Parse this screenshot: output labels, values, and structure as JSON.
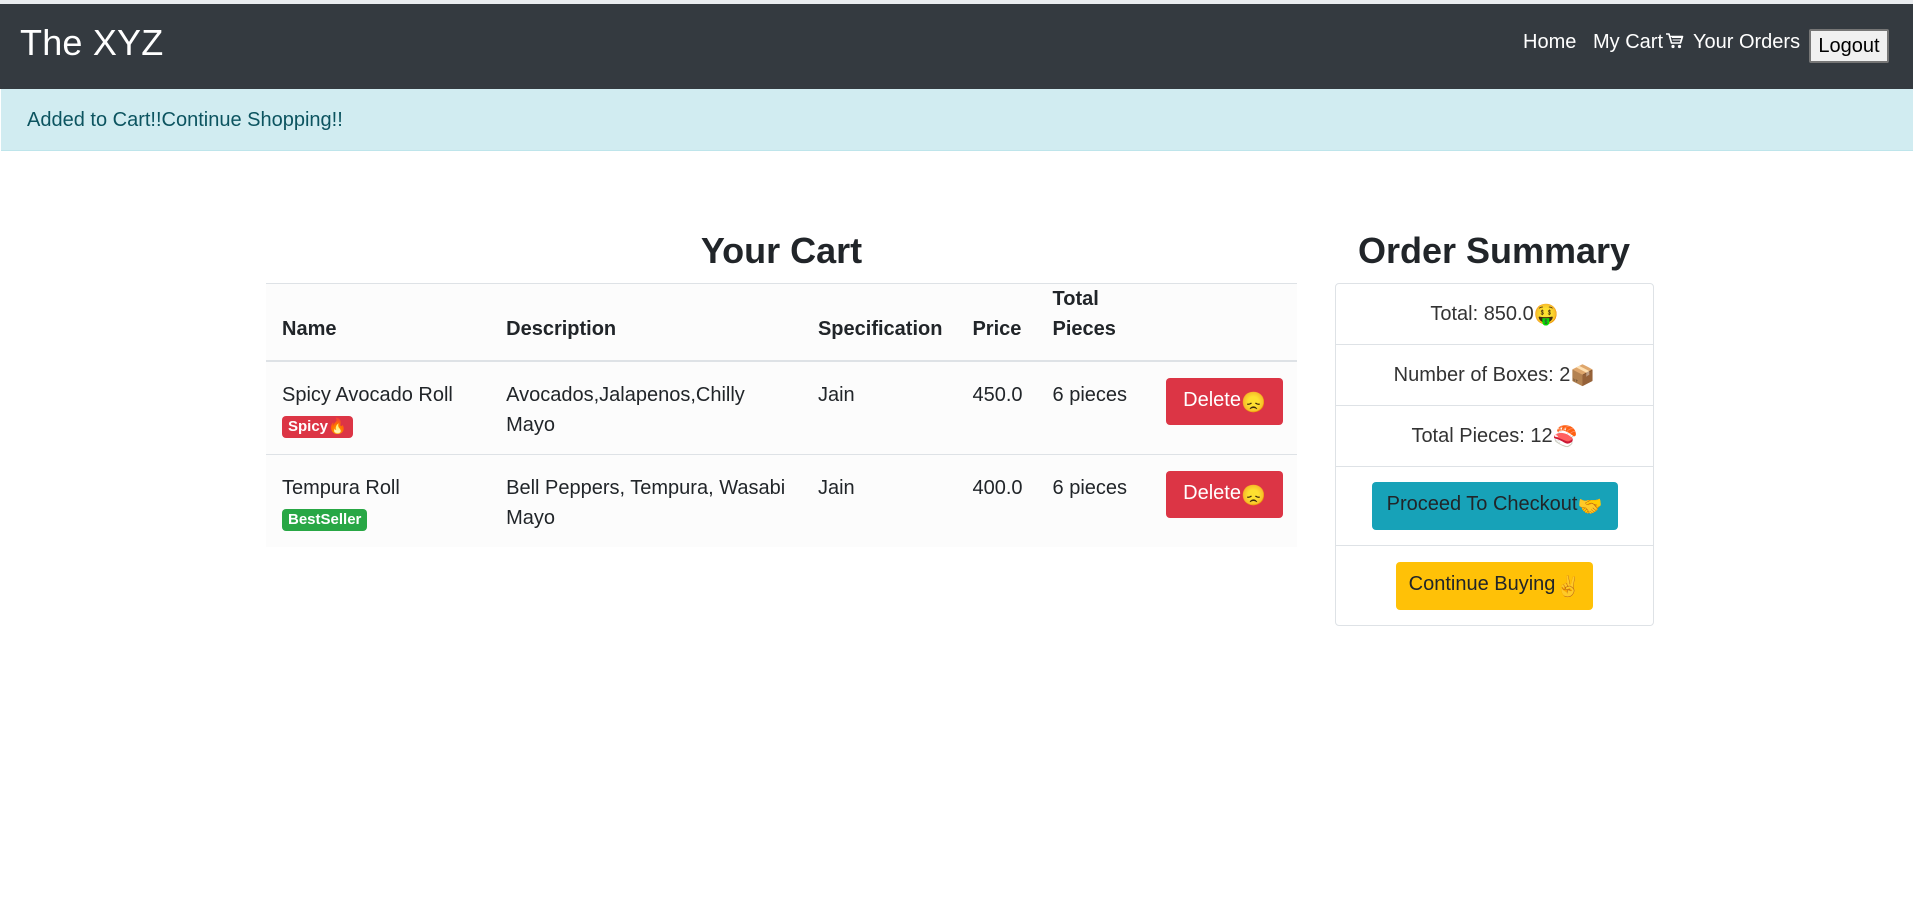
{
  "navbar": {
    "brand": "The XYZ",
    "links": {
      "home": "Home",
      "cart": "My Cart",
      "orders": "Your Orders"
    },
    "logout": "Logout",
    "cart_icon": "shopping-cart-icon"
  },
  "alert": {
    "text": "Added to Cart!!Continue Shopping!!"
  },
  "cart": {
    "title": "Your Cart",
    "headers": {
      "name": "Name",
      "description": "Description",
      "specification": "Specification",
      "price": "Price",
      "total_pieces": "Total Pieces"
    },
    "rows": [
      {
        "name": "Spicy Avocado Roll",
        "badge": "Spicy",
        "badge_emoji": "🔥",
        "badge_color": "#dc3545",
        "description": "Avocados,Jalapenos,Chilly Mayo",
        "specification": "Jain",
        "price": "450.0",
        "pieces": "6 pieces",
        "delete_label": "Delete",
        "delete_emoji": "😞"
      },
      {
        "name": "Tempura Roll",
        "badge": "BestSeller",
        "badge_color": "#28a745",
        "description": "Bell Peppers, Tempura, Wasabi Mayo",
        "specification": "Jain",
        "price": "400.0",
        "pieces": "6 pieces",
        "delete_label": "Delete",
        "delete_emoji": "😞"
      }
    ]
  },
  "summary": {
    "title": "Order Summary",
    "total_label": "Total: 850.0",
    "total_emoji": "🤑",
    "boxes_label": "Number of Boxes: 2",
    "boxes_emoji": "📦",
    "pieces_label": "Total Pieces: 12",
    "pieces_emoji": "🍣",
    "checkout_label": "Proceed To Checkout",
    "checkout_emoji": "🤝",
    "continue_label": "Continue Buying",
    "continue_emoji": "✌"
  },
  "colors": {
    "navbar": "#343a40",
    "alert_bg": "#d1ecf1",
    "alert_text": "#0c5460",
    "danger": "#dc3545",
    "success": "#28a745",
    "info": "#17a2b8",
    "warning": "#ffc107"
  }
}
